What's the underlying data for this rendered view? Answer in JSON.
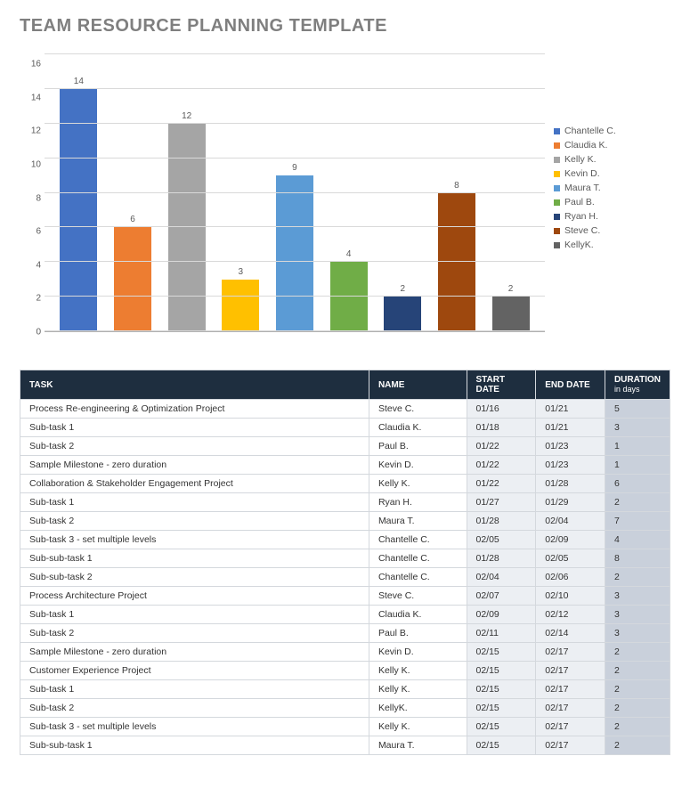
{
  "title": "TEAM RESOURCE PLANNING TEMPLATE",
  "chart_data": {
    "type": "bar",
    "categories": [
      "Chantelle C.",
      "Claudia K.",
      "Kelly K.",
      "Kevin D.",
      "Maura T.",
      "Paul B.",
      "Ryan H.",
      "Steve C.",
      "KellyK."
    ],
    "values": [
      14,
      6,
      12,
      3,
      9,
      4,
      2,
      8,
      2
    ],
    "colors": [
      "#4472c4",
      "#ed7d31",
      "#a5a5a5",
      "#ffc000",
      "#5b9bd5",
      "#70ad47",
      "#264478",
      "#9e480e",
      "#636363"
    ],
    "ylim": [
      0,
      16
    ],
    "ytick": 2,
    "title": "",
    "xlabel": "",
    "ylabel": ""
  },
  "table": {
    "headers": {
      "task": "TASK",
      "name": "NAME",
      "start": "START DATE",
      "end": "END DATE",
      "duration": "DURATION",
      "duration_sub": "in days"
    },
    "rows": [
      {
        "task": "Process Re-engineering & Optimization Project",
        "name": "Steve C.",
        "start": "01/16",
        "end": "01/21",
        "dur": "5"
      },
      {
        "task": "Sub-task 1",
        "name": "Claudia K.",
        "start": "01/18",
        "end": "01/21",
        "dur": "3"
      },
      {
        "task": "Sub-task 2",
        "name": "Paul B.",
        "start": "01/22",
        "end": "01/23",
        "dur": "1"
      },
      {
        "task": "Sample Milestone - zero duration",
        "name": "Kevin D.",
        "start": "01/22",
        "end": "01/23",
        "dur": "1"
      },
      {
        "task": "Collaboration & Stakeholder Engagement Project",
        "name": "Kelly K.",
        "start": "01/22",
        "end": "01/28",
        "dur": "6"
      },
      {
        "task": "Sub-task 1",
        "name": "Ryan H.",
        "start": "01/27",
        "end": "01/29",
        "dur": "2"
      },
      {
        "task": "Sub-task 2",
        "name": "Maura T.",
        "start": "01/28",
        "end": "02/04",
        "dur": "7"
      },
      {
        "task": "Sub-task 3 - set multiple levels",
        "name": "Chantelle C.",
        "start": "02/05",
        "end": "02/09",
        "dur": "4"
      },
      {
        "task": "Sub-sub-task 1",
        "name": "Chantelle C.",
        "start": "01/28",
        "end": "02/05",
        "dur": "8"
      },
      {
        "task": "Sub-sub-task 2",
        "name": "Chantelle C.",
        "start": "02/04",
        "end": "02/06",
        "dur": "2"
      },
      {
        "task": "Process Architecture Project",
        "name": "Steve C.",
        "start": "02/07",
        "end": "02/10",
        "dur": "3"
      },
      {
        "task": "Sub-task 1",
        "name": "Claudia K.",
        "start": "02/09",
        "end": "02/12",
        "dur": "3"
      },
      {
        "task": "Sub-task 2",
        "name": "Paul B.",
        "start": "02/11",
        "end": "02/14",
        "dur": "3"
      },
      {
        "task": "Sample Milestone - zero duration",
        "name": "Kevin D.",
        "start": "02/15",
        "end": "02/17",
        "dur": "2"
      },
      {
        "task": "Customer Experience Project",
        "name": "Kelly K.",
        "start": "02/15",
        "end": "02/17",
        "dur": "2"
      },
      {
        "task": "Sub-task 1",
        "name": "Kelly K.",
        "start": "02/15",
        "end": "02/17",
        "dur": "2"
      },
      {
        "task": "Sub-task 2",
        "name": "KellyK.",
        "start": "02/15",
        "end": "02/17",
        "dur": "2"
      },
      {
        "task": "Sub-task 3 - set multiple levels",
        "name": "Kelly K.",
        "start": "02/15",
        "end": "02/17",
        "dur": "2"
      },
      {
        "task": "Sub-sub-task 1",
        "name": "Maura T.",
        "start": "02/15",
        "end": "02/17",
        "dur": "2"
      }
    ]
  }
}
